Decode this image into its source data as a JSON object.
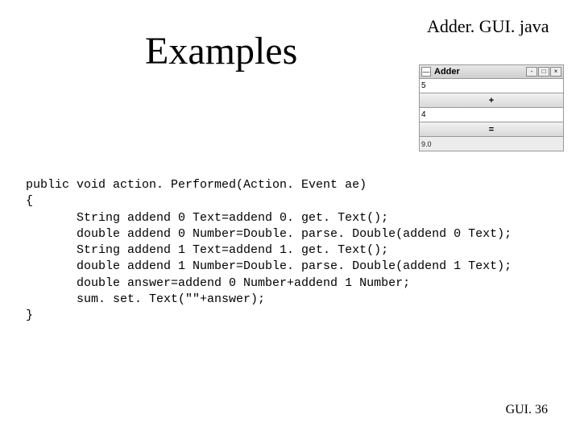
{
  "filename": "Adder. GUI. java",
  "title": "Examples",
  "window": {
    "title_text": "Adder",
    "sys_icon": "—",
    "minimize": "-",
    "maximize": "□",
    "close": "×",
    "input0": "5",
    "plus": "+",
    "input1": "4",
    "equals": "=",
    "result": "9.0"
  },
  "code": {
    "l1": "public void action. Performed(Action. Event ae)",
    "l2": "{",
    "l3": "       String addend 0 Text=addend 0. get. Text();",
    "l4": "       double addend 0 Number=Double. parse. Double(addend 0 Text);",
    "l5": "       String addend 1 Text=addend 1. get. Text();",
    "l6": "       double addend 1 Number=Double. parse. Double(addend 1 Text);",
    "l7": "       double answer=addend 0 Number+addend 1 Number;",
    "l8": "       sum. set. Text(\"\"+answer);",
    "l9": "}"
  },
  "footer": "GUI. 36"
}
